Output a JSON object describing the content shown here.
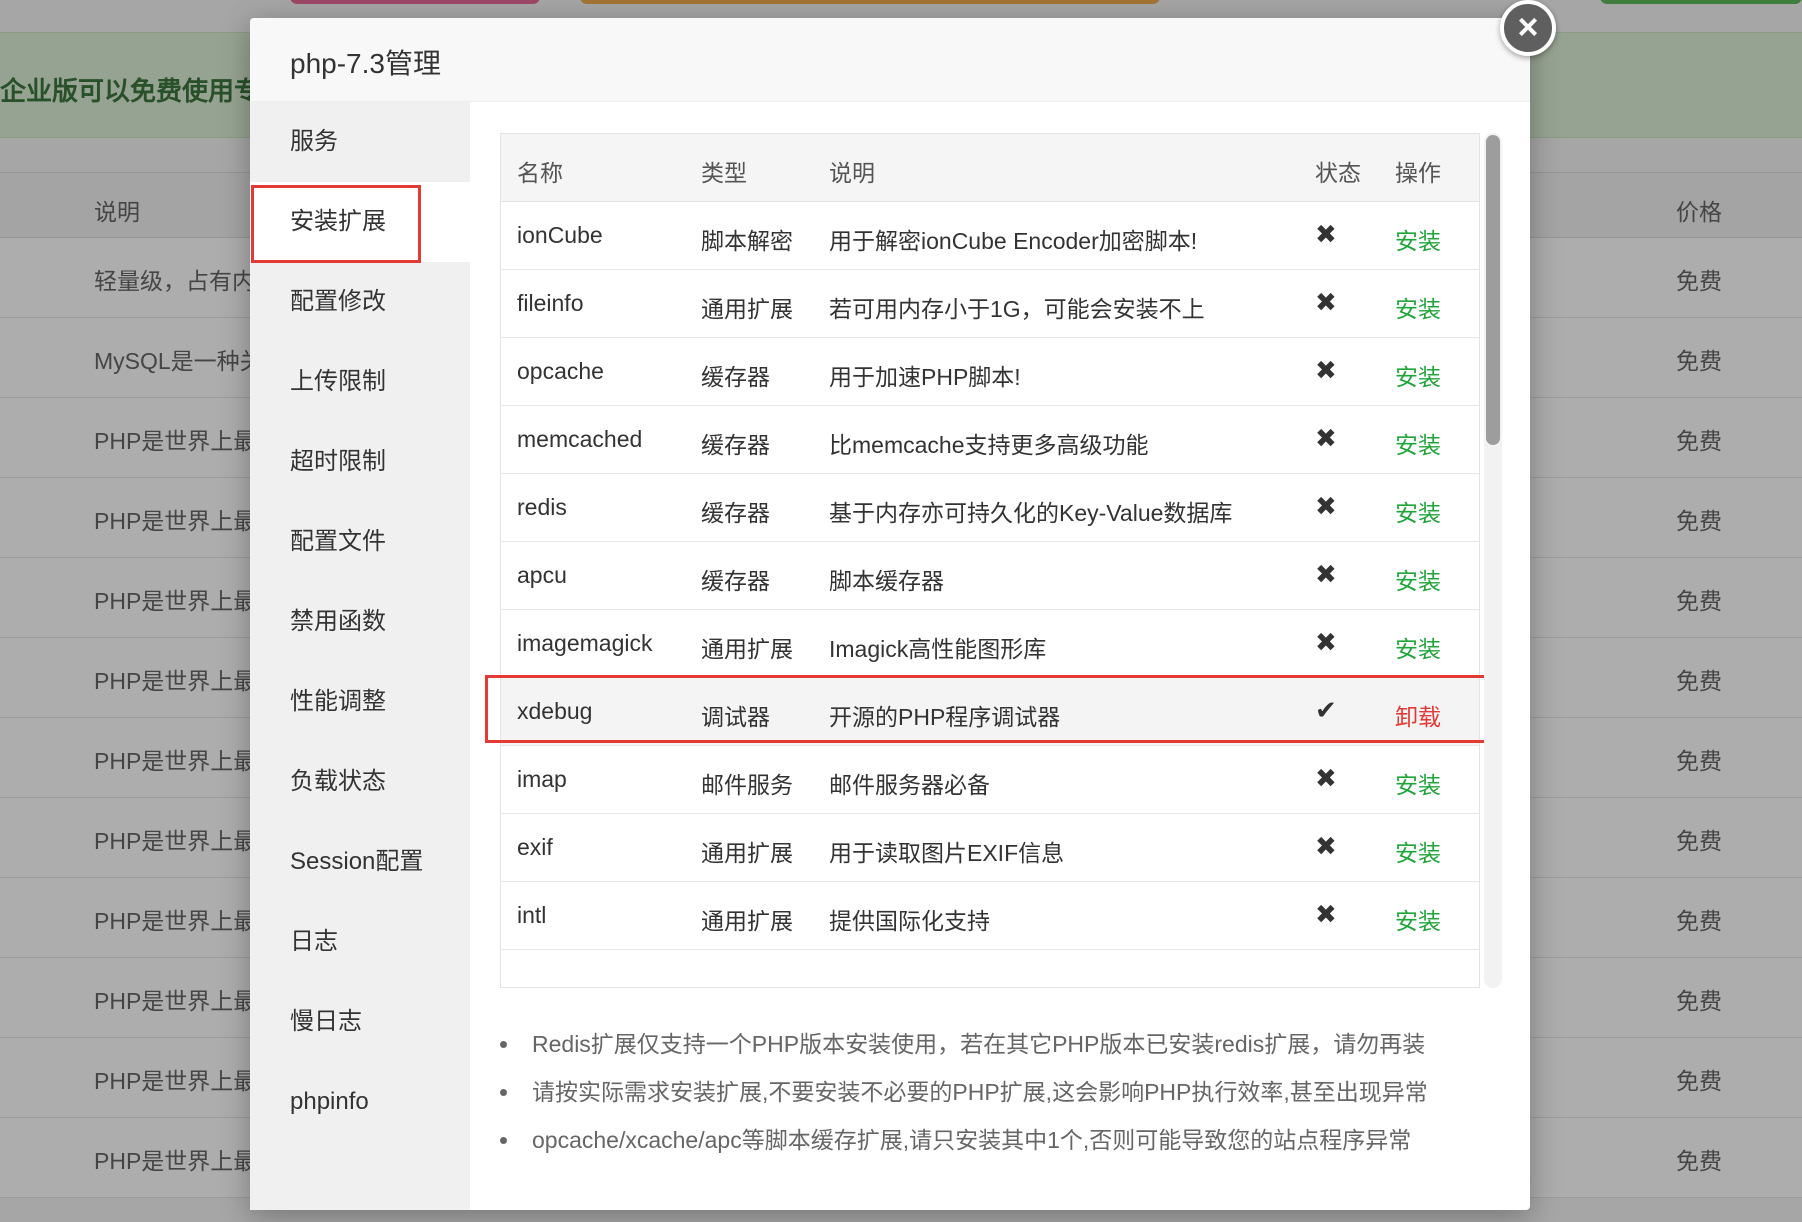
{
  "background": {
    "banner_text": "企业版可以免费使用专",
    "columns": {
      "desc": "说明",
      "price": "价格"
    },
    "rows": [
      {
        "desc": "轻量级，占有内",
        "price": "免费"
      },
      {
        "desc": "MySQL是一种关",
        "price": "免费"
      },
      {
        "desc": "PHP是世界上最",
        "price": "免费"
      },
      {
        "desc": "PHP是世界上最",
        "price": "免费"
      },
      {
        "desc": "PHP是世界上最",
        "price": "免费"
      },
      {
        "desc": "PHP是世界上最",
        "price": "免费"
      },
      {
        "desc": "PHP是世界上最",
        "price": "免费"
      },
      {
        "desc": "PHP是世界上最",
        "price": "免费"
      },
      {
        "desc": "PHP是世界上最",
        "price": "免费"
      },
      {
        "desc": "PHP是世界上最",
        "price": "免费"
      },
      {
        "desc": "PHP是世界上最",
        "price": "免费"
      },
      {
        "desc": "PHP是世界上最",
        "price": "免费"
      }
    ]
  },
  "modal": {
    "title": "php-7.3管理",
    "close_symbol": "×",
    "sidebar": [
      {
        "label": "服务"
      },
      {
        "label": "安装扩展"
      },
      {
        "label": "配置修改"
      },
      {
        "label": "上传限制"
      },
      {
        "label": "超时限制"
      },
      {
        "label": "配置文件"
      },
      {
        "label": "禁用函数"
      },
      {
        "label": "性能调整"
      },
      {
        "label": "负载状态"
      },
      {
        "label": "Session配置"
      },
      {
        "label": "日志"
      },
      {
        "label": "慢日志"
      },
      {
        "label": "phpinfo"
      }
    ],
    "active_sidebar": "安装扩展",
    "table": {
      "headers": {
        "name": "名称",
        "type": "类型",
        "desc": "说明",
        "status": "状态",
        "action": "操作"
      },
      "rows": [
        {
          "name": "ionCube",
          "type": "脚本解密",
          "desc": "用于解密ionCube Encoder加密脚本!",
          "status": "✖",
          "action": "安装"
        },
        {
          "name": "fileinfo",
          "type": "通用扩展",
          "desc": "若可用内存小于1G，可能会安装不上",
          "status": "✖",
          "action": "安装"
        },
        {
          "name": "opcache",
          "type": "缓存器",
          "desc": "用于加速PHP脚本!",
          "status": "✖",
          "action": "安装"
        },
        {
          "name": "memcached",
          "type": "缓存器",
          "desc": "比memcache支持更多高级功能",
          "status": "✖",
          "action": "安装"
        },
        {
          "name": "redis",
          "type": "缓存器",
          "desc": "基于内存亦可持久化的Key-Value数据库",
          "status": "✖",
          "action": "安装"
        },
        {
          "name": "apcu",
          "type": "缓存器",
          "desc": "脚本缓存器",
          "status": "✖",
          "action": "安装"
        },
        {
          "name": "imagemagick",
          "type": "通用扩展",
          "desc": "Imagick高性能图形库",
          "status": "✖",
          "action": "安装"
        },
        {
          "name": "xdebug",
          "type": "调试器",
          "desc": "开源的PHP程序调试器",
          "status": "✔",
          "action": "卸载"
        },
        {
          "name": "imap",
          "type": "邮件服务",
          "desc": "邮件服务器必备",
          "status": "✖",
          "action": "安装"
        },
        {
          "name": "exif",
          "type": "通用扩展",
          "desc": "用于读取图片EXIF信息",
          "status": "✖",
          "action": "安装"
        },
        {
          "name": "intl",
          "type": "通用扩展",
          "desc": "提供国际化支持",
          "status": "✖",
          "action": "安装"
        }
      ]
    },
    "notes": [
      "Redis扩展仅支持一个PHP版本安装使用，若在其它PHP版本已安装redis扩展，请勿再装",
      "请按实际需求安装扩展,不要安装不必要的PHP扩展,这会影响PHP执行效率,甚至出现异常",
      "opcache/xcache/apc等脚本缓存扩展,请只安装其中1个,否则可能导致您的站点程序异常"
    ]
  },
  "colors": {
    "install": "#20a53a",
    "uninstall": "#e53935",
    "highlight_border": "#e53935",
    "banner_bg": "#dff0d8"
  },
  "icons": {
    "status_not_installed": "cross-icon",
    "status_installed": "check-icon",
    "close": "close-icon"
  }
}
